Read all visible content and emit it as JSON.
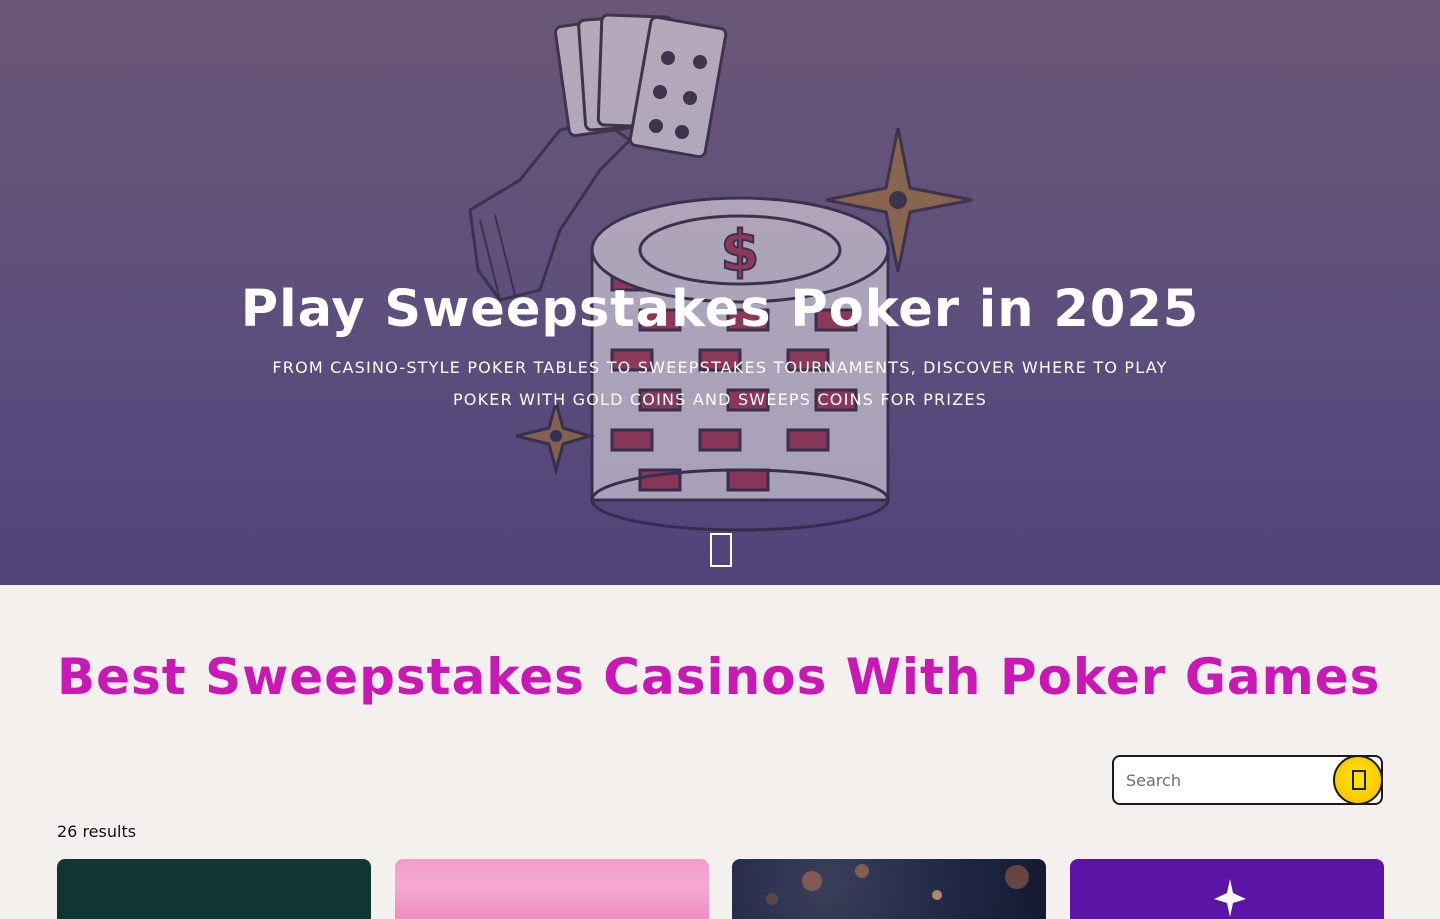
{
  "hero": {
    "title": "Play Sweepstakes Poker in 2025",
    "subtitle": "From casino-style poker tables to sweepstakes tournaments, discover where to play poker with Gold Coins and Sweeps Coins for prizes",
    "scroll_icon": "scroll-down-icon",
    "illustration": "hand-holding-cards-and-poker-chip-stack"
  },
  "listing": {
    "title": "Best Sweepstakes Casinos With Poker Games",
    "results_text": "26 results"
  },
  "search": {
    "placeholder": "Search",
    "button_icon": "search-icon"
  },
  "colors": {
    "accent": "#c918b5",
    "search_button": "#ffe600",
    "hero_overlay": "#5d4f7c",
    "page_background": "#f4f0ee"
  },
  "cards": [
    {
      "name": "casino-card-1",
      "background": "#0f3631"
    },
    {
      "name": "casino-card-2",
      "background": "#f5a9d2"
    },
    {
      "name": "casino-card-3",
      "background": "#1f2744"
    },
    {
      "name": "casino-card-4",
      "background": "#5a14a6"
    }
  ]
}
